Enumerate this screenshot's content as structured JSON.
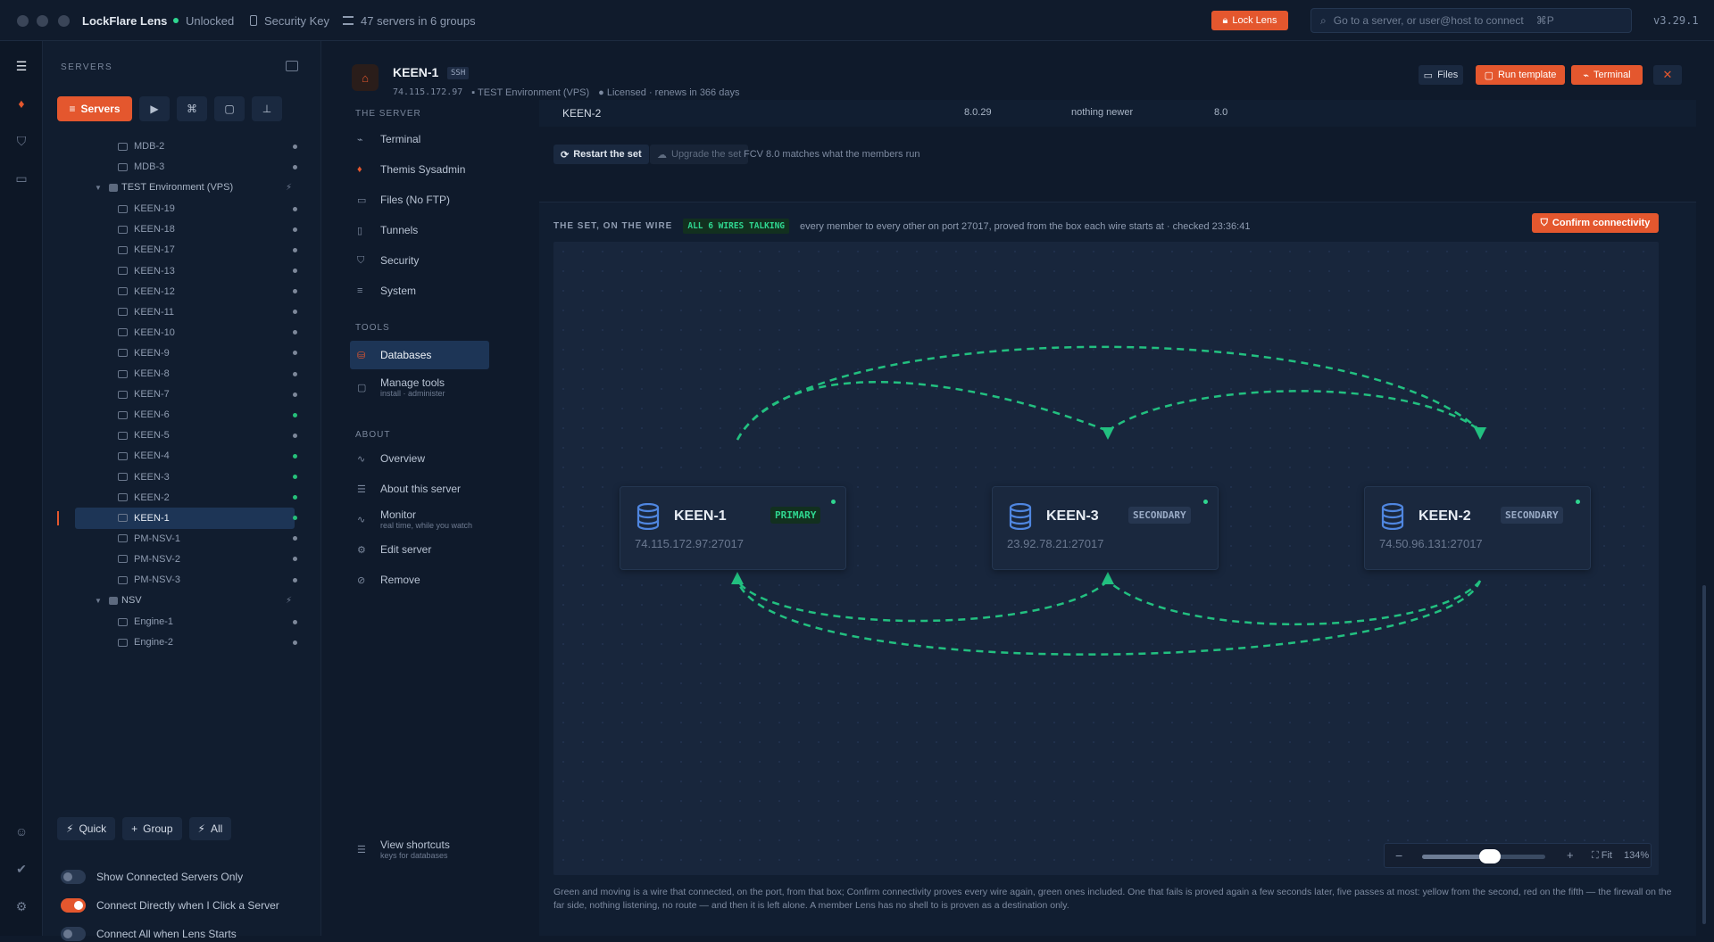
{
  "app": {
    "name": "LockFlare Lens",
    "status": "Unlocked",
    "key": "Security Key",
    "servers_summary": "47 servers in 6 groups",
    "lock_label": "Lock Lens",
    "search_placeholder": "Go to a server, or user@host to connect",
    "search_shortcut": "⌘P",
    "version": "v3.29.1"
  },
  "sidebar": {
    "title": "SERVERS",
    "active_tab": "Servers",
    "rows": [
      {
        "label": "MDB-2",
        "type": "server",
        "online": false
      },
      {
        "label": "MDB-3",
        "type": "server",
        "online": false
      },
      {
        "label": "TEST Environment (VPS)",
        "type": "group"
      },
      {
        "label": "KEEN-19",
        "type": "server",
        "online": false
      },
      {
        "label": "KEEN-18",
        "type": "server",
        "online": false
      },
      {
        "label": "KEEN-17",
        "type": "server",
        "online": false
      },
      {
        "label": "KEEN-13",
        "type": "server",
        "online": false
      },
      {
        "label": "KEEN-12",
        "type": "server",
        "online": false
      },
      {
        "label": "KEEN-11",
        "type": "server",
        "online": false
      },
      {
        "label": "KEEN-10",
        "type": "server",
        "online": false
      },
      {
        "label": "KEEN-9",
        "type": "server",
        "online": false
      },
      {
        "label": "KEEN-8",
        "type": "server",
        "online": false
      },
      {
        "label": "KEEN-7",
        "type": "server",
        "online": false
      },
      {
        "label": "KEEN-6",
        "type": "server",
        "online": true
      },
      {
        "label": "KEEN-5",
        "type": "server",
        "online": false
      },
      {
        "label": "KEEN-4",
        "type": "server",
        "online": true
      },
      {
        "label": "KEEN-3",
        "type": "server",
        "online": true
      },
      {
        "label": "KEEN-2",
        "type": "server",
        "online": true
      },
      {
        "label": "KEEN-1",
        "type": "server",
        "online": true,
        "selected": true
      },
      {
        "label": "PM-NSV-1",
        "type": "server",
        "online": false
      },
      {
        "label": "PM-NSV-2",
        "type": "server",
        "online": false
      },
      {
        "label": "PM-NSV-3",
        "type": "server",
        "online": false
      },
      {
        "label": "NSV",
        "type": "group"
      },
      {
        "label": "Engine-1",
        "type": "server",
        "online": false
      },
      {
        "label": "Engine-2",
        "type": "server",
        "online": false
      }
    ],
    "actions": {
      "quick": "Quick",
      "group": "Group",
      "all": "All"
    },
    "toggles": [
      {
        "label": "Show Connected Servers Only",
        "on": false
      },
      {
        "label": "Connect Directly when I Click a Server",
        "on": true
      },
      {
        "label": "Connect All when Lens Starts",
        "on": false
      }
    ]
  },
  "server": {
    "name": "KEEN-1",
    "protocol": "SSH",
    "ip": "74.115.172.97",
    "group": "TEST Environment (VPS)",
    "license": "Licensed · renews in 366 days"
  },
  "header_buttons": {
    "files": "Files",
    "run_template": "Run template",
    "terminal": "Terminal"
  },
  "subnav": {
    "the_server": "THE SERVER",
    "items1": [
      "Terminal",
      "Themis Sysadmin",
      "Files (No FTP)",
      "Tunnels",
      "Security",
      "System"
    ],
    "tools": "TOOLS",
    "databases": "Databases",
    "manage_tools": "Manage tools",
    "manage_tools_sub": "install · administer",
    "about": "ABOUT",
    "overview": "Overview",
    "about_server": "About this server",
    "monitor": "Monitor",
    "monitor_sub": "real time, while you watch",
    "edit": "Edit server",
    "remove": "Remove",
    "shortcuts": "View shortcuts",
    "shortcuts_sub": "keys for databases"
  },
  "table_row": {
    "name": "KEEN-2",
    "version": "8.0.29",
    "update": "nothing newer",
    "fcv": "8.0"
  },
  "set_actions": {
    "restart": "Restart the set",
    "upgrade": "Upgrade the set",
    "note": "FCV 8.0 matches what the members run"
  },
  "wire": {
    "title": "THE SET, ON THE WIRE",
    "badge": "ALL 6 WIRES TALKING",
    "desc": "every member to every other on port 27017, proved from the box each wire starts at · checked 23:36:41",
    "confirm": "Confirm connectivity"
  },
  "nodes": [
    {
      "name": "KEEN-1",
      "role": "PRIMARY",
      "addr": "74.115.172.97:27017"
    },
    {
      "name": "KEEN-3",
      "role": "SECONDARY",
      "addr": "23.92.78.21:27017"
    },
    {
      "name": "KEEN-2",
      "role": "SECONDARY",
      "addr": "74.50.96.131:27017"
    }
  ],
  "zoom": {
    "fit": "Fit",
    "level": "134%",
    "value": 0.55
  },
  "footnote": "Green and moving is a wire that connected, on the port, from that box; Confirm connectivity proves every wire again, green ones included. One that fails is proved again a few seconds later, five passes at most: yellow from the second, red on the fifth — the firewall on the far side, nothing listening, no route — and then it is left alone. A member Lens has no shell to is proven as a destination only.",
  "colors": {
    "accent": "#e4572e",
    "ok": "#2fd690",
    "wire": "#22c080"
  }
}
